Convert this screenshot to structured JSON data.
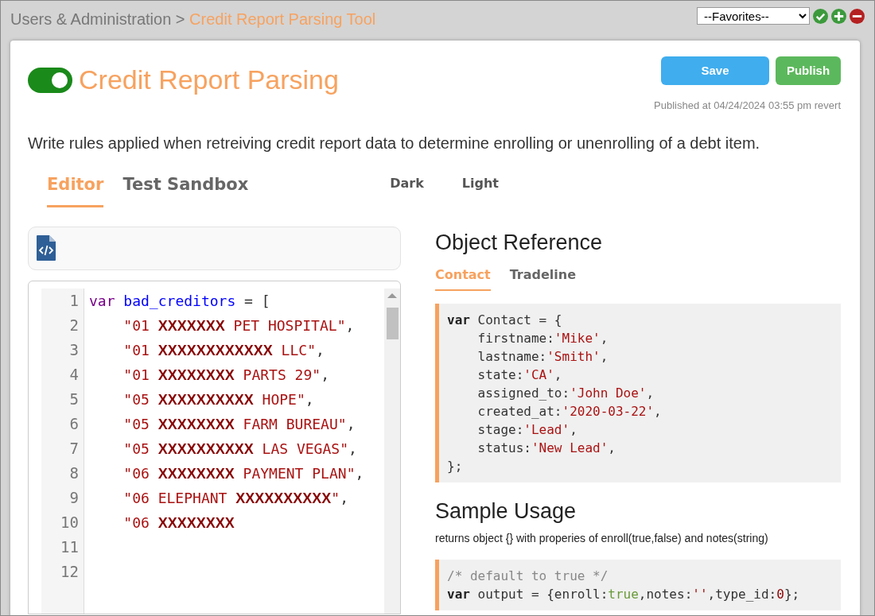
{
  "breadcrumb": {
    "parent": "Users & Administration",
    "separator": ">",
    "current": "Credit Report Parsing Tool"
  },
  "favorites": {
    "value": "--Favorites--"
  },
  "page": {
    "title": "Credit Report Parsing",
    "enabled": true,
    "buttons": [
      {
        "label": "Save",
        "kind": "save"
      },
      {
        "label": "Publish",
        "kind": "publish"
      }
    ],
    "published": "Published at 04/24/2024 03:55 pm",
    "revert": "revert",
    "description": "Write rules applied when retreiving credit report data to determine enrolling or unenrolling of a debt item."
  },
  "tabs": [
    {
      "label": "Editor",
      "selected": true
    },
    {
      "label": "Test Sandbox",
      "selected": false
    }
  ],
  "themes": [
    {
      "label": "Dark"
    },
    {
      "label": "Light"
    }
  ],
  "editor": {
    "lines": [
      {
        "number": "1",
        "tokens": [
          {
            "kind": "kw",
            "text": "var "
          },
          {
            "kind": "var",
            "text": "bad_creditors"
          },
          {
            "kind": "plain",
            "text": " = ["
          }
        ]
      },
      {
        "number": "2",
        "tokens": [
          {
            "kind": "str",
            "text": "    \"01 "
          },
          {
            "kind": "mask",
            "text": "XXXXXXX"
          },
          {
            "kind": "str",
            "text": " PET HOSPITAL\""
          },
          {
            "kind": "plain",
            "text": ","
          }
        ]
      },
      {
        "number": "3",
        "tokens": [
          {
            "kind": "str",
            "text": "    \"01 "
          },
          {
            "kind": "mask",
            "text": "XXXXXXXXXXXX"
          },
          {
            "kind": "str",
            "text": " LLC\""
          },
          {
            "kind": "plain",
            "text": ","
          }
        ]
      },
      {
        "number": "4",
        "tokens": [
          {
            "kind": "str",
            "text": "    \"01 "
          },
          {
            "kind": "mask",
            "text": "XXXXXXXX"
          },
          {
            "kind": "str",
            "text": " PARTS 29\""
          },
          {
            "kind": "plain",
            "text": ","
          }
        ]
      },
      {
        "number": "5",
        "tokens": [
          {
            "kind": "str",
            "text": "    \"05 "
          },
          {
            "kind": "mask",
            "text": "XXXXXXXXXX"
          },
          {
            "kind": "str",
            "text": " HOPE\""
          },
          {
            "kind": "plain",
            "text": ","
          }
        ]
      },
      {
        "number": "6",
        "tokens": [
          {
            "kind": "str",
            "text": "    \"05 "
          },
          {
            "kind": "mask",
            "text": "XXXXXXXX"
          },
          {
            "kind": "str",
            "text": " FARM BUREAU\""
          },
          {
            "kind": "plain",
            "text": ","
          }
        ]
      },
      {
        "number": "7",
        "tokens": [
          {
            "kind": "str",
            "text": "    \"05 "
          },
          {
            "kind": "mask",
            "text": "XXXXXXXXXX"
          },
          {
            "kind": "str",
            "text": " LAS VEGAS\""
          },
          {
            "kind": "plain",
            "text": ","
          }
        ]
      },
      {
        "number": "8",
        "tokens": [
          {
            "kind": "str",
            "text": "    \"06 "
          },
          {
            "kind": "mask",
            "text": "XXXXXXXX"
          },
          {
            "kind": "str",
            "text": " PAYMENT PLAN\""
          },
          {
            "kind": "plain",
            "text": ","
          }
        ]
      },
      {
        "number": "9",
        "tokens": [
          {
            "kind": "str",
            "text": "    \"06 ELEPHANT "
          },
          {
            "kind": "mask",
            "text": "XXXXXXXXXX"
          },
          {
            "kind": "str",
            "text": "\""
          },
          {
            "kind": "plain",
            "text": ","
          }
        ]
      },
      {
        "number": "10",
        "tokens": [
          {
            "kind": "str",
            "text": "    \"06 "
          },
          {
            "kind": "mask",
            "text": "XXXXXXXX"
          }
        ]
      },
      {
        "number": "11"
      },
      {
        "number": "12"
      }
    ]
  },
  "reference": {
    "title": "Object Reference",
    "tabs": [
      {
        "label": "Contact",
        "selected": true
      },
      {
        "label": "Tradeline",
        "selected": false
      }
    ],
    "code": [
      [
        {
          "kind": "kwb",
          "text": "var "
        },
        {
          "kind": "plain",
          "text": "Contact = {"
        }
      ],
      [
        {
          "kind": "plain",
          "text": "    firstname:"
        },
        {
          "kind": "str",
          "text": "'Mike'"
        },
        {
          "kind": "plain",
          "text": ","
        }
      ],
      [
        {
          "kind": "plain",
          "text": "    lastname:"
        },
        {
          "kind": "str",
          "text": "'Smith'"
        },
        {
          "kind": "plain",
          "text": ","
        }
      ],
      [
        {
          "kind": "plain",
          "text": "    state:"
        },
        {
          "kind": "str",
          "text": "'CA'"
        },
        {
          "kind": "plain",
          "text": ","
        }
      ],
      [
        {
          "kind": "plain",
          "text": "    assigned_to:"
        },
        {
          "kind": "str",
          "text": "'John Doe'"
        },
        {
          "kind": "plain",
          "text": ","
        }
      ],
      [
        {
          "kind": "plain",
          "text": "    created_at:"
        },
        {
          "kind": "str",
          "text": "'2020-03-22'"
        },
        {
          "kind": "plain",
          "text": ","
        }
      ],
      [
        {
          "kind": "plain",
          "text": "    stage:"
        },
        {
          "kind": "str",
          "text": "'Lead'"
        },
        {
          "kind": "plain",
          "text": ","
        }
      ],
      [
        {
          "kind": "plain",
          "text": "    status:"
        },
        {
          "kind": "str",
          "text": "'New Lead'"
        },
        {
          "kind": "plain",
          "text": ","
        }
      ],
      [
        {
          "kind": "plain",
          "text": "};"
        }
      ]
    ],
    "usage_title": "Sample Usage",
    "usage_text": "returns object {} with properies of enroll(true,false) and notes(string)",
    "usage_code": [
      [
        {
          "kind": "comment",
          "text": "/* default to true */"
        }
      ],
      [
        {
          "kind": "kwb",
          "text": "var "
        },
        {
          "kind": "plain",
          "text": "output = {enroll:"
        },
        {
          "kind": "bool",
          "text": "true"
        },
        {
          "kind": "plain",
          "text": ",notes:"
        },
        {
          "kind": "str",
          "text": "''"
        },
        {
          "kind": "plain",
          "text": ",type_id:"
        },
        {
          "kind": "num",
          "text": "0"
        },
        {
          "kind": "plain",
          "text": "};"
        }
      ]
    ]
  }
}
